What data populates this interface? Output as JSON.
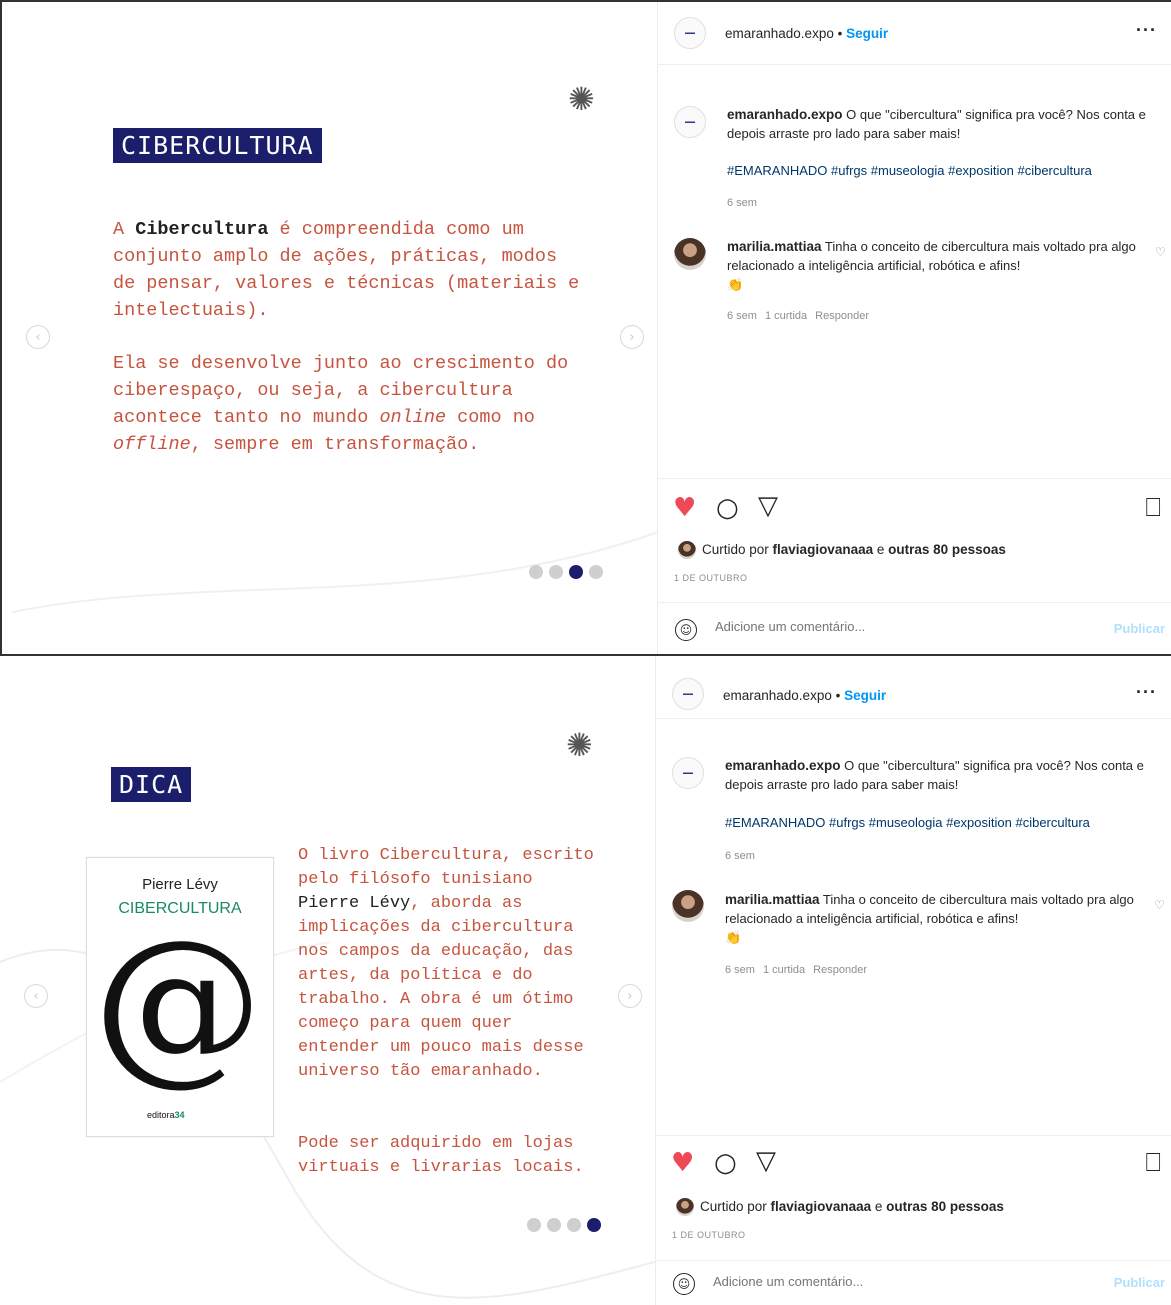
{
  "colors": {
    "accent_navy": "#1b1f6b",
    "slide_text": "#c6543f",
    "link_blue": "#0095f6",
    "heart_red": "#ed4956"
  },
  "posts": [
    {
      "slide": {
        "tag": "CIBERCULTURA",
        "para1_pre": "A ",
        "para1_bold": "Cibercultura",
        "para1_rest": " é compreendida como um conjunto amplo de ações, práticas, modos de pensar, valores e técnicas (materiais e intelectuais).",
        "para2_a": "Ela se desenvolve junto ao crescimento do ciberespaço, ou seja, a cibercultura acontece tanto no mundo ",
        "para2_i1": "online",
        "para2_b": " como no ",
        "para2_i2": "offline",
        "para2_c": ", sempre em transformação.",
        "dots_active_index": 2,
        "dots_total": 4
      },
      "sidebar": {
        "username": "emaranhado.expo",
        "separator": "•",
        "follow": "Seguir",
        "more": "···",
        "caption_user": "emaranhado.expo",
        "caption_text": " O que \"cibercultura\" significa pra você? Nos conta e depois arraste pro lado para saber mais!",
        "hashtags": "#EMARANHADO #ufrgs #museologia #exposition #cibercultura",
        "caption_time": "6 sem",
        "comment_user": "marilia.mattiaa",
        "comment_text": " Tinha o conceito de cibercultura mais voltado pra algo relacionado a inteligência artificial, robótica e afins!",
        "comment_emoji": "👏",
        "comment_time": "6 sem",
        "comment_likes": "1 curtida",
        "comment_reply": "Responder",
        "liked_pre": "Curtido por ",
        "liked_user": "flaviagiovanaaa",
        "liked_mid": " e ",
        "liked_others": "outras 80 pessoas",
        "date": "1 DE OUTUBRO",
        "comment_placeholder": "Adicione um comentário...",
        "publish": "Publicar"
      }
    },
    {
      "slide": {
        "tag": "DICA",
        "book_author": "Pierre Lévy",
        "book_title": "CIBERCULTURA",
        "book_symbol": "@",
        "book_publisher_a": "editora",
        "book_publisher_b": "34",
        "para1_a": "O livro Cibercultura, escrito pelo filósofo tunisiano ",
        "para1_name": "Pierre Lévy",
        "para1_b": ", aborda as implicações da cibercultura nos campos da educação, das artes, da política e do trabalho. A obra é um ótimo começo para quem quer entender um pouco mais desse universo tão emaranhado.",
        "para2": "Pode ser adquirido em lojas virtuais e livrarias locais.",
        "dots_active_index": 3,
        "dots_total": 4
      },
      "sidebar": {
        "username": "emaranhado.expo",
        "separator": "•",
        "follow": "Seguir",
        "more": "···",
        "caption_user": "emaranhado.expo",
        "caption_text": " O que \"cibercultura\" significa pra você? Nos conta e depois arraste pro lado para saber mais!",
        "hashtags": "#EMARANHADO #ufrgs #museologia #exposition #cibercultura",
        "caption_time": "6 sem",
        "comment_user": "marilia.mattiaa",
        "comment_text": " Tinha o conceito de cibercultura mais voltado pra algo relacionado a inteligência artificial, robótica e afins!",
        "comment_emoji": "👏",
        "comment_time": "6 sem",
        "comment_likes": "1 curtida",
        "comment_reply": "Responder",
        "liked_pre": "Curtido por ",
        "liked_user": "flaviagiovanaaa",
        "liked_mid": " e ",
        "liked_others": "outras 80 pessoas",
        "date": "1 DE OUTUBRO",
        "comment_placeholder": "Adicione um comentário...",
        "publish": "Publicar"
      }
    }
  ],
  "icons": {
    "heart": "heart-icon",
    "comment": "comment-icon",
    "share": "share-icon",
    "save": "bookmark-icon",
    "emoji": "emoji-icon",
    "swirl": "logo-swirl-icon"
  }
}
